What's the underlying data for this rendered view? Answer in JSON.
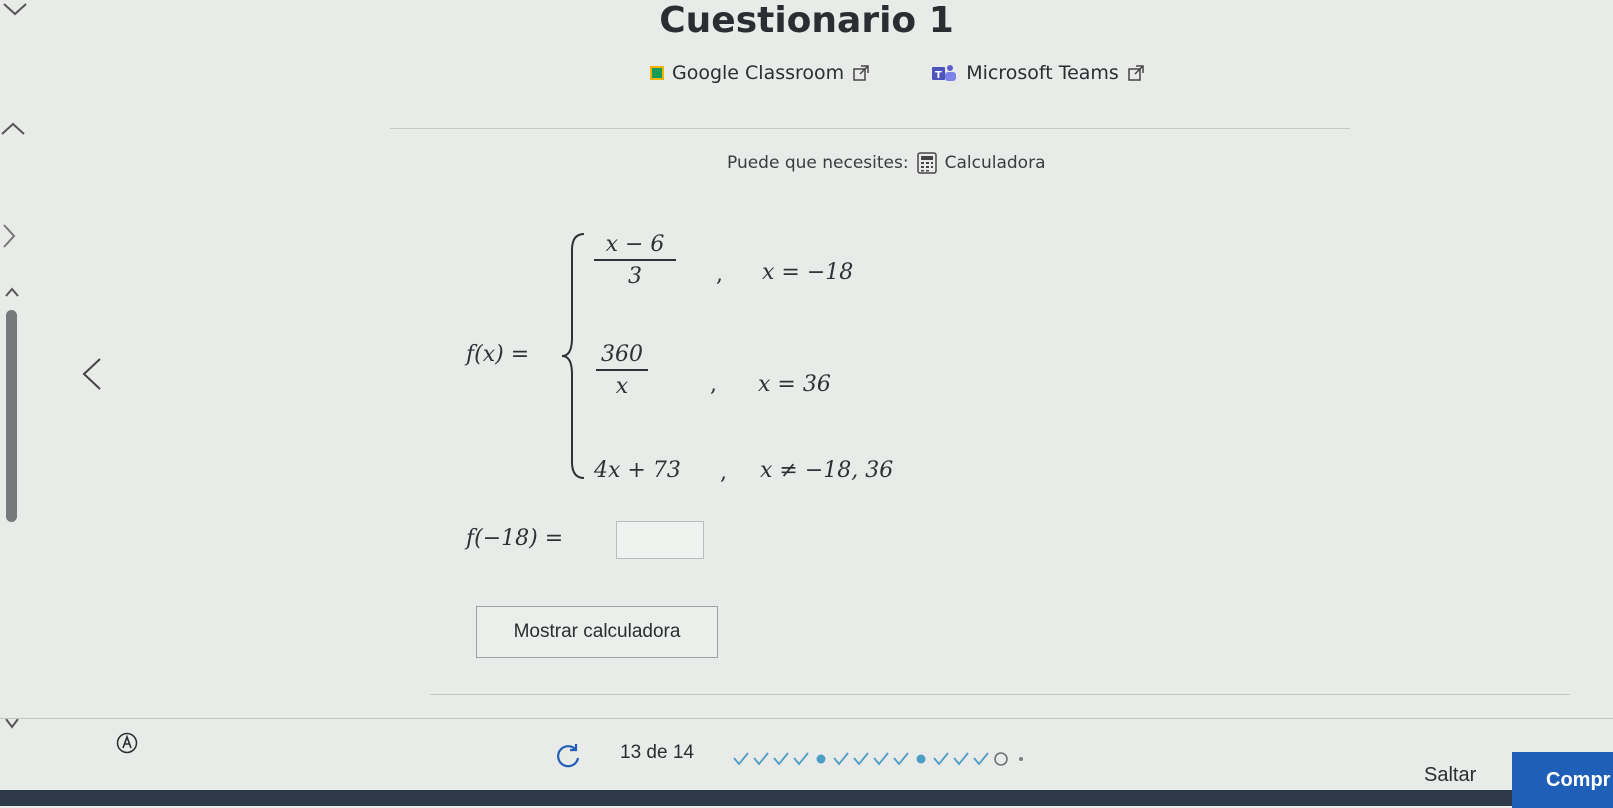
{
  "header": {
    "title": "Cuestionario 1",
    "classroom_label": "Google Classroom",
    "teams_label": "Microsoft Teams"
  },
  "tools": {
    "prompt": "Puede que necesites:",
    "calculator_label": "Calculadora"
  },
  "problem": {
    "fx": "f(x) =",
    "case1_num": "x − 6",
    "case1_den": "3",
    "case1_cond": "x = −18",
    "case2_num": "360",
    "case2_den": "x",
    "case2_cond": "x = 36",
    "case3_expr": "4x + 73",
    "case3_cond": "x ≠ −18, 36",
    "separator": ",",
    "question": "f(−18) =",
    "answer_value": ""
  },
  "buttons": {
    "show_calculator": "Mostrar calculadora",
    "skip": "Saltar",
    "check": "Compr"
  },
  "progress": {
    "text": "13 de 14",
    "current": 13,
    "total": 14,
    "states": [
      "correct",
      "correct",
      "correct",
      "correct",
      "dot",
      "correct",
      "correct",
      "correct",
      "correct",
      "dot",
      "correct",
      "correct",
      "correct",
      "current",
      "empty"
    ]
  },
  "colors": {
    "primary": "#1f5fb8",
    "correct": "#4c9ec4",
    "classroom": "#0f9d58",
    "teams": "#5b5fc7"
  }
}
